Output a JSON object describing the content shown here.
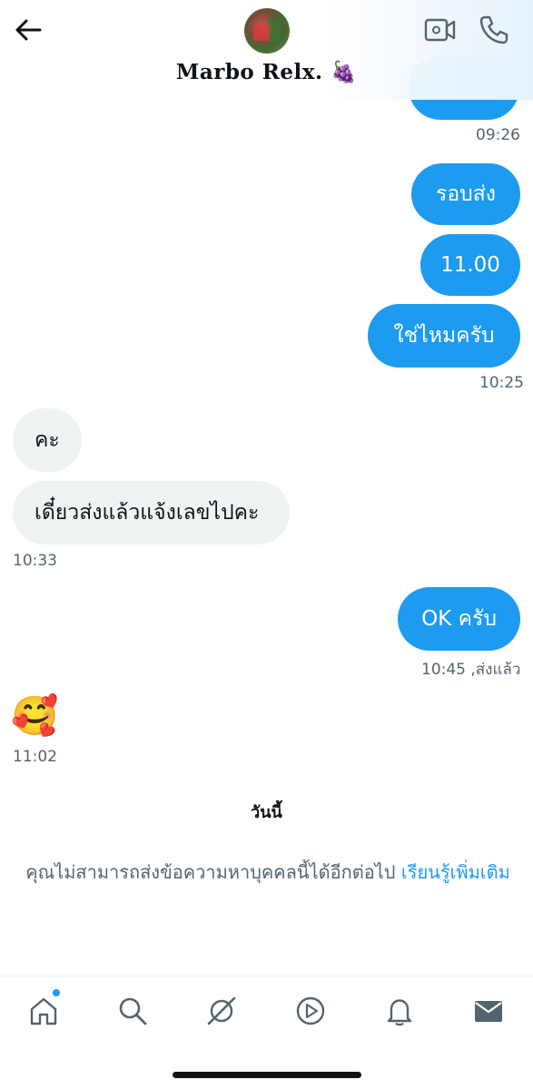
{
  "header": {
    "contact_name": "Marbo Relx. 🍇",
    "back_icon": "arrow-left-icon",
    "video_icon": "video-camera-icon",
    "phone_icon": "phone-icon"
  },
  "messages": {
    "top_timestamp": "09:26",
    "sent_1": "รอบส่ง",
    "sent_2": "11.00",
    "sent_3": "ใช่ไหมครับ",
    "sent_group_timestamp": "10:25",
    "recv_1": "คะ",
    "recv_2": "เดี๋ยวส่งแล้วแจ้งเลขไปคะ",
    "recv_group_timestamp": "10:33",
    "sent_4": "OK ครับ",
    "sent_4_status": "10:45 ,ส่งแล้ว",
    "recv_emoji": "🥰",
    "recv_emoji_timestamp": "11:02"
  },
  "today_label": "วันนี้",
  "notice": {
    "text": "คุณไม่สามารถส่งข้อความหาบุคคลนี้ได้อีกต่อไป ",
    "link": "เรียนรู้เพิ่มเติม"
  },
  "nav": {
    "items": [
      "home-icon",
      "search-icon",
      "spaces-icon",
      "video-play-icon",
      "bell-icon",
      "mail-icon"
    ]
  },
  "colors": {
    "accent": "#1d9bf0",
    "received_bubble": "#eff3f4",
    "secondary_text": "#536471"
  }
}
